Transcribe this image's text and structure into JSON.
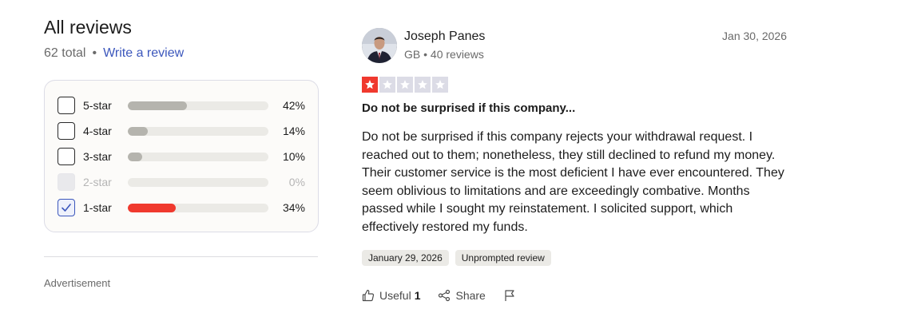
{
  "summary": {
    "title": "All reviews",
    "total": "62 total",
    "separator": "•",
    "write_review": "Write a review"
  },
  "filters": [
    {
      "label": "5-star",
      "percent": "42%",
      "fraction": 0.42,
      "checked": false,
      "disabled": false
    },
    {
      "label": "4-star",
      "percent": "14%",
      "fraction": 0.14,
      "checked": false,
      "disabled": false
    },
    {
      "label": "3-star",
      "percent": "10%",
      "fraction": 0.1,
      "checked": false,
      "disabled": false
    },
    {
      "label": "2-star",
      "percent": "0%",
      "fraction": 0.0,
      "checked": false,
      "disabled": true
    },
    {
      "label": "1-star",
      "percent": "34%",
      "fraction": 0.34,
      "checked": true,
      "disabled": false
    }
  ],
  "colors": {
    "bar_default": "#b5b4ae",
    "bar_one_star": "#f0392e",
    "star_filled": "#f0392e",
    "star_empty": "#dcdce6",
    "link": "#3c57bc"
  },
  "advertisement": "Advertisement",
  "review": {
    "author": "Joseph Panes",
    "meta": "GB • 40 reviews",
    "date": "Jan 30, 2026",
    "rating": 1,
    "max_rating": 5,
    "title": "Do not be surprised if this company...",
    "body": "Do not be surprised if this company rejects your withdrawal request. I reached out to them; nonetheless, they still declined to refund my money. Their customer service is the most deficient I have ever encountered. They seem oblivious to limitations and are exceedingly combative. Months passed while I sought my reinstatement. I solicited support, which effectively restored my funds.",
    "tags": [
      "January 29, 2026",
      "Unprompted review"
    ],
    "useful_label": "Useful",
    "useful_count": "1",
    "share_label": "Share"
  },
  "icons": {
    "useful": "thumbs-up-icon",
    "share": "share-icon",
    "report": "flag-icon",
    "check": "check-icon",
    "star": "star-icon"
  }
}
